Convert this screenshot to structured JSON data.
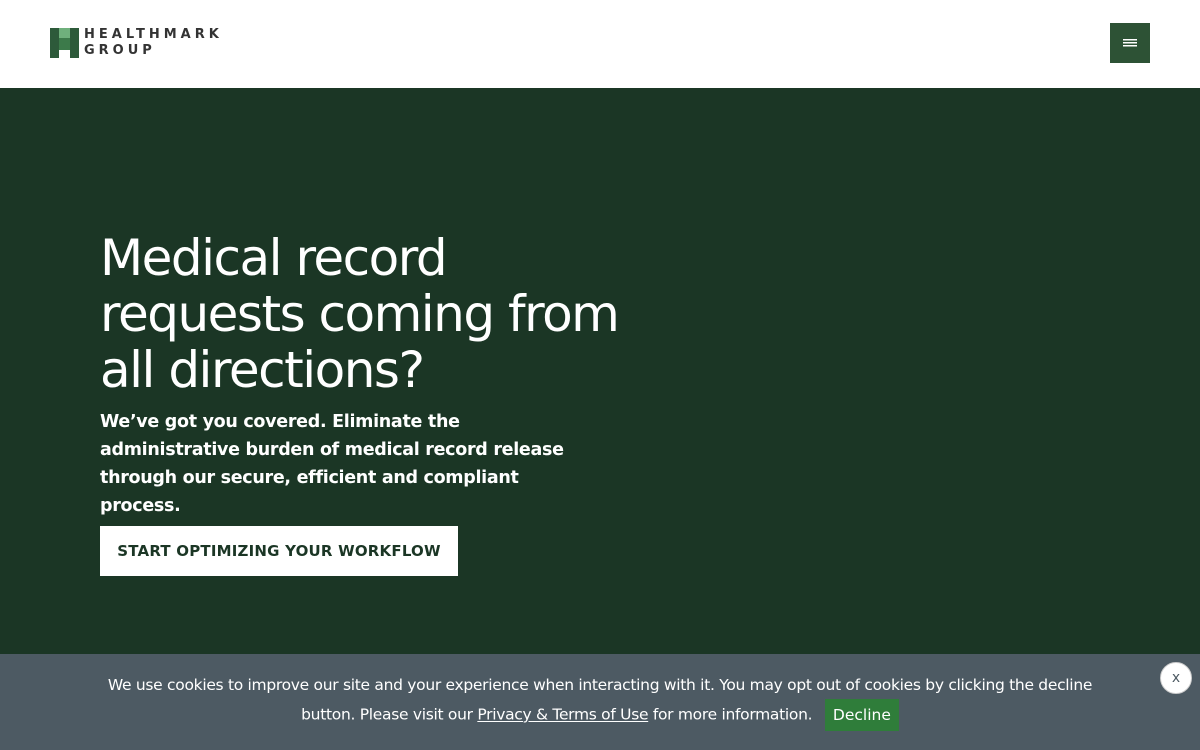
{
  "header": {
    "logo": {
      "line1": "HEALTHMARK",
      "line2": "GROUP",
      "icon": "healthmark-m-logo-icon",
      "colors": {
        "dark": "#2d5a3a",
        "light": "#6fb07c"
      }
    },
    "menu_button": {
      "icon": "hamburger-menu-icon",
      "color": "#2d5235"
    }
  },
  "hero": {
    "background": "#1b3625",
    "title": "Medical record requests coming from all directions?",
    "subtitle": "We’ve got you covered. Eliminate the administrative burden of medical record release through our secure, efficient and compliant process.",
    "cta_label": "START OPTIMIZING YOUR WORKFLOW"
  },
  "cookie_banner": {
    "background": "#4d5a63",
    "text_before": "We use cookies to improve our site and your experience when interacting with it. You may opt out of cookies by clicking the decline button. Please visit our",
    "link_text": "Privacy & Terms of Use",
    "text_after": "for more information.",
    "decline_label": "Decline",
    "decline_color": "#2f7d3a",
    "close_label": "x"
  }
}
